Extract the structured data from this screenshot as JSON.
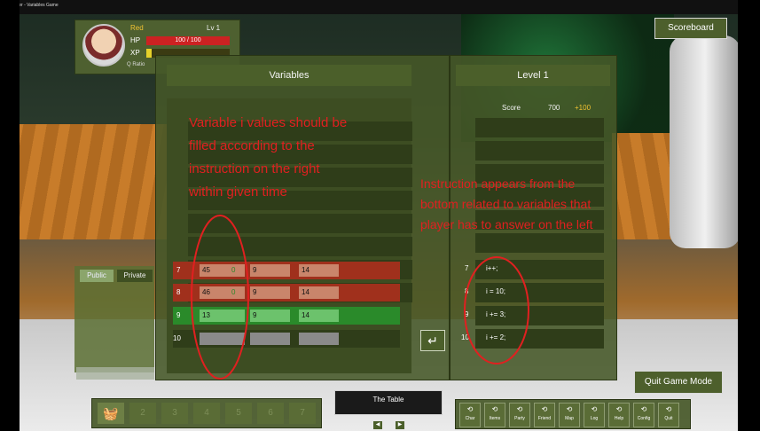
{
  "window": {
    "title": "zakhigger - Variables Game",
    "controls": "▸ ✦ <"
  },
  "player": {
    "name": "Red",
    "level": "Lv 1",
    "hp_label": "HP",
    "hp_text": "100 / 100",
    "hp_ratio": 1.0,
    "xp_label": "XP",
    "ratio_label": "Q Ratio"
  },
  "header": {
    "scoreboard": "Scoreboard"
  },
  "variables_panel": {
    "title": "Variables",
    "rows": [
      {
        "num": "7",
        "i": "45",
        "i_suffix": "0",
        "b": "9",
        "c": "14",
        "state": "red"
      },
      {
        "num": "8",
        "i": "46",
        "i_suffix": "0",
        "b": "9",
        "c": "14",
        "state": "red"
      },
      {
        "num": "9",
        "i": "13",
        "i_suffix": "",
        "b": "9",
        "c": "14",
        "state": "green"
      },
      {
        "num": "10",
        "i": "",
        "i_suffix": "",
        "b": "",
        "c": "",
        "state": "empty"
      }
    ]
  },
  "level_panel": {
    "title": "Level 1",
    "score_label": "Score",
    "score_value": "700",
    "score_bonus": "+100",
    "instructions": [
      {
        "num": "7",
        "text": "i++;"
      },
      {
        "num": "8",
        "text": "i = 10;"
      },
      {
        "num": "9",
        "text": "i += 3;"
      },
      {
        "num": "10",
        "text": "i += 2;"
      }
    ]
  },
  "chat": {
    "tab_public": "Public",
    "tab_private": "Private"
  },
  "quit": {
    "label": "Quit Game Mode"
  },
  "hotbar": {
    "slots": [
      "2",
      "3",
      "4",
      "5",
      "6",
      "7"
    ]
  },
  "table": {
    "label": "The Table"
  },
  "menu": {
    "buttons": [
      "Char",
      "Items",
      "Party",
      "Friend",
      "Map",
      "Log",
      "Help",
      "Config",
      "Quit"
    ]
  },
  "annotations": {
    "left": [
      "Variable i values should be",
      "filled according to the",
      "instruction on the right",
      "within given time"
    ],
    "right": [
      "Instruction appears from the",
      "bottom related to variables that",
      "player has to answer on the left"
    ]
  },
  "colors": {
    "annot": "#e02020",
    "panel": "#465828",
    "row_red": "#a0301c",
    "row_green": "#2a8a2a"
  }
}
